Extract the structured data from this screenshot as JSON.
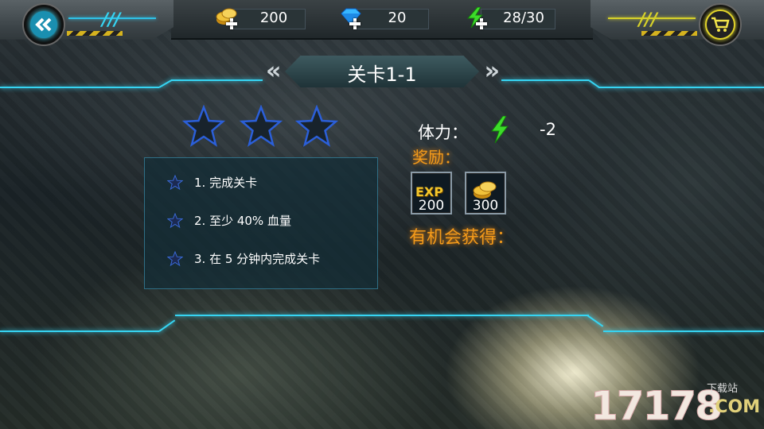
{
  "top_bar": {
    "back_button_icon": "double-chevron-left-icon",
    "shop_button_icon": "shopping-cart-icon",
    "resources": [
      {
        "name": "coins",
        "icon": "gold-coins-plus-icon",
        "value": "200"
      },
      {
        "name": "diamonds",
        "icon": "blue-diamond-plus-icon",
        "value": "20"
      },
      {
        "name": "stamina",
        "icon": "green-lightning-plus-icon",
        "value": "28/30"
      }
    ]
  },
  "stage": {
    "title": "关卡1-1"
  },
  "star_conditions": [
    {
      "text": "1. 完成关卡"
    },
    {
      "text": "2. 至少 40% 血量"
    },
    {
      "text": "3. 在 5 分钟内完成关卡"
    }
  ],
  "stars_earned": 0,
  "stamina": {
    "label": "体力：",
    "cost": "-2"
  },
  "reward": {
    "label": "奖励：",
    "items": [
      {
        "icon": "exp-icon",
        "badge": "EXP",
        "amount": "200"
      },
      {
        "icon": "gold-coins-icon",
        "amount": "300"
      }
    ]
  },
  "chance": {
    "label": "有机会获得："
  },
  "watermark": {
    "number": "17178",
    "site": "下载站",
    "domain": ".COM"
  },
  "colors": {
    "accent_cyan": "#36d4f2",
    "reward_orange": "#f39a1a",
    "stamina_green": "#3ddc2a"
  }
}
